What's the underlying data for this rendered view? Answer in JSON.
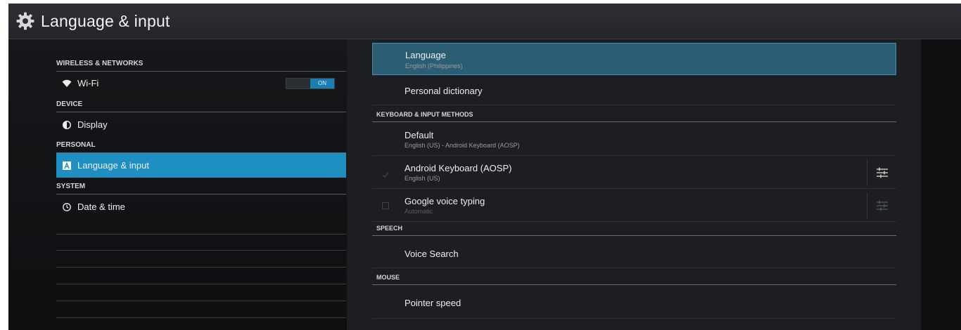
{
  "action_bar": {
    "title": "Language & input",
    "icon": "gear-icon"
  },
  "left_pane": {
    "categories": {
      "wireless": "WIRELESS & NETWORKS",
      "device": "DEVICE",
      "personal": "PERSONAL",
      "system": "SYSTEM"
    },
    "items": {
      "wifi": {
        "label": "Wi-Fi",
        "icon": "wifi-icon",
        "toggle": "ON"
      },
      "display": {
        "label": "Display",
        "icon": "brightness-icon"
      },
      "language": {
        "label": "Language & input",
        "icon": "keyboard-a-icon"
      },
      "datetime": {
        "label": "Date & time",
        "icon": "clock-icon"
      }
    }
  },
  "right_pane": {
    "language": {
      "title": "Language",
      "summary": "English (Philippines)"
    },
    "personal_dictionary": {
      "title": "Personal dictionary"
    },
    "keyboard_header": "KEYBOARD & INPUT METHODS",
    "default": {
      "title": "Default",
      "summary": "English (US) - Android Keyboard (AOSP)"
    },
    "android_keyboard": {
      "title": "Android Keyboard (AOSP)",
      "summary": "English (US)",
      "checked": true
    },
    "google_voice": {
      "title": "Google voice typing",
      "summary": "Automatic",
      "checked": false
    },
    "speech_header": "SPEECH",
    "voice_search": {
      "title": "Voice Search"
    },
    "mouse_header": "MOUSE",
    "pointer_speed": {
      "title": "Pointer speed"
    }
  },
  "colors": {
    "accent": "#1e8fc0",
    "selected_row": "#2b5d75",
    "background": "#111316"
  }
}
